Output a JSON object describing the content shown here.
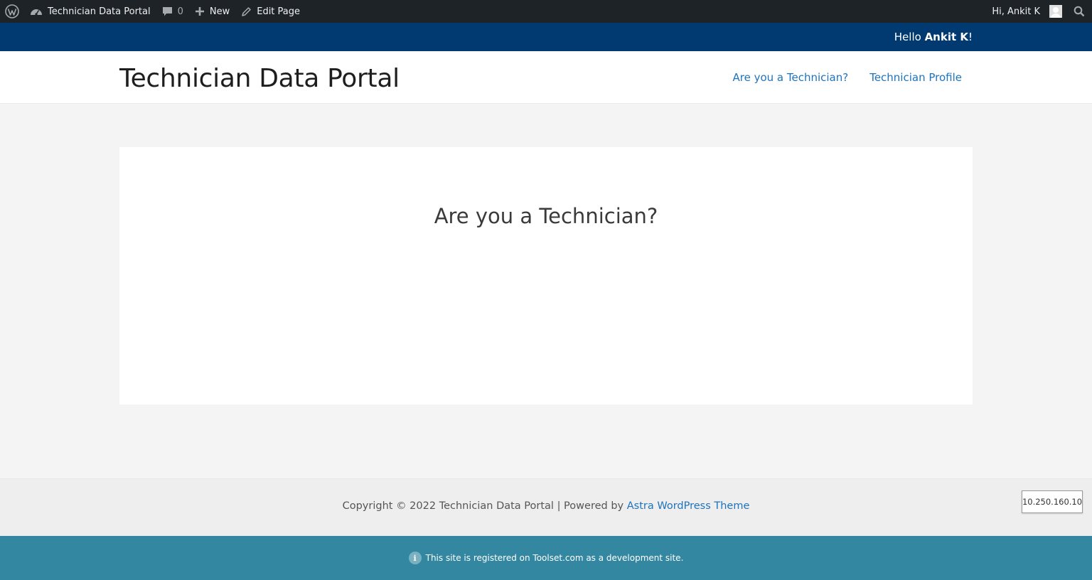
{
  "adminbar": {
    "site_name": "Technician Data Portal",
    "comments_count": "0",
    "new_label": "New",
    "edit_label": "Edit Page",
    "greeting": "Hi, Ankit K"
  },
  "topbar": {
    "hello_prefix": "Hello ",
    "user_name": "Ankit K",
    "hello_suffix": "!"
  },
  "header": {
    "site_title": "Technician Data Portal",
    "nav": [
      {
        "label": "Are you a Technician?"
      },
      {
        "label": "Technician Profile"
      }
    ]
  },
  "main": {
    "heading": "Are you a Technician?"
  },
  "footer": {
    "copyright_text": "Copyright © 2022 Technician Data Portal | Powered by ",
    "theme_link": "Astra WordPress Theme",
    "ip_address": "10.250.160.10"
  },
  "devbar": {
    "message": "This site is registered on Toolset.com as a development site."
  },
  "colors": {
    "adminbar_bg": "#1d2327",
    "topbar_bg": "#003a70",
    "link": "#1e73be",
    "devbar_bg": "#3387a0"
  }
}
